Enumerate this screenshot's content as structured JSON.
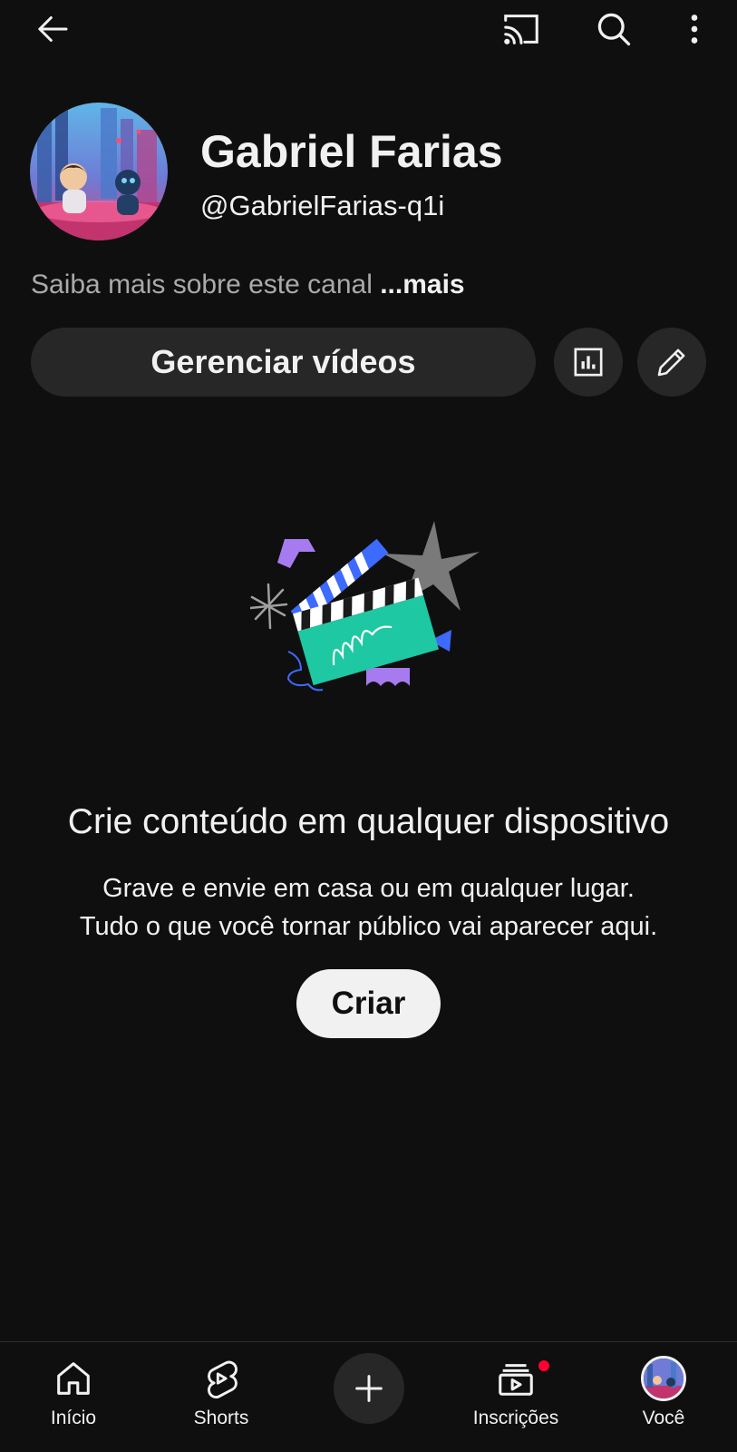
{
  "topbar": {
    "back_icon": "arrow-left-icon",
    "cast_icon": "cast-icon",
    "search_icon": "search-icon",
    "menu_icon": "more-vertical-icon"
  },
  "channel": {
    "name": "Gabriel Farias",
    "handle": "@GabrielFarias-q1i",
    "avatar_icon": "channel-avatar"
  },
  "about": {
    "text": "Saiba mais sobre este canal",
    "more": "...mais"
  },
  "actions": {
    "manage_label": "Gerenciar vídeos",
    "analytics_icon": "analytics-icon",
    "edit_icon": "pencil-icon"
  },
  "empty_state": {
    "title": "Crie conteúdo em qualquer dispositivo",
    "line1": "Grave e envie em casa ou em qualquer lugar.",
    "line2": "Tudo o que você tornar público vai aparecer aqui.",
    "create_label": "Criar"
  },
  "bottom_nav": {
    "items": [
      {
        "label": "Início",
        "icon": "home-icon"
      },
      {
        "label": "Shorts",
        "icon": "shorts-icon"
      },
      {
        "label": "",
        "icon": "plus-icon"
      },
      {
        "label": "Inscrições",
        "icon": "subscriptions-icon"
      },
      {
        "label": "Você",
        "icon": "you-avatar"
      }
    ]
  },
  "colors": {
    "background": "#0f0f0f",
    "surface": "#272727",
    "text": "#f1f1f1",
    "muted": "#aaaaaa",
    "notification": "#ff0033"
  }
}
